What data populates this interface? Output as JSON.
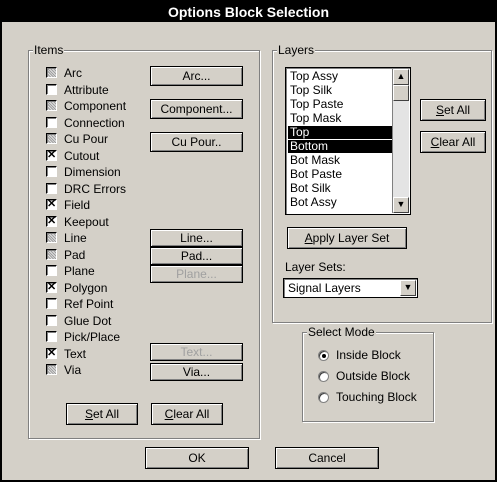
{
  "title": "Options Block Selection",
  "items_group": {
    "label": "Items",
    "checkboxes": [
      {
        "label": "Arc",
        "state": "indeterminate"
      },
      {
        "label": "Attribute",
        "state": "unchecked"
      },
      {
        "label": "Component",
        "state": "indeterminate"
      },
      {
        "label": "Connection",
        "state": "unchecked"
      },
      {
        "label": "Cu Pour",
        "state": "indeterminate"
      },
      {
        "label": "Cutout",
        "state": "checked"
      },
      {
        "label": "Dimension",
        "state": "unchecked"
      },
      {
        "label": "DRC Errors",
        "state": "unchecked"
      },
      {
        "label": "Field",
        "state": "checked"
      },
      {
        "label": "Keepout",
        "state": "checked"
      },
      {
        "label": "Line",
        "state": "indeterminate"
      },
      {
        "label": "Pad",
        "state": "indeterminate"
      },
      {
        "label": "Plane",
        "state": "unchecked"
      },
      {
        "label": "Polygon",
        "state": "checked"
      },
      {
        "label": "Ref Point",
        "state": "unchecked"
      },
      {
        "label": "Glue Dot",
        "state": "unchecked"
      },
      {
        "label": "Pick/Place",
        "state": "unchecked"
      },
      {
        "label": "Text",
        "state": "checked"
      },
      {
        "label": "Via",
        "state": "indeterminate"
      }
    ],
    "buttons": {
      "arc": "Arc...",
      "component": "Component...",
      "cu_pour": "Cu Pour..",
      "line": "Line...",
      "pad": "Pad...",
      "plane": "Plane...",
      "text": "Text...",
      "via": "Via..."
    },
    "set_all": "Set All",
    "clear_all": "Clear All"
  },
  "layers_group": {
    "label": "Layers",
    "items": [
      "Top Assy",
      "Top Silk",
      "Top Paste",
      "Top Mask",
      "Top",
      "Bottom",
      "Bot Mask",
      "Bot Paste",
      "Bot Silk",
      "Bot Assy"
    ],
    "selected": [
      "Top",
      "Bottom"
    ],
    "set_all": "Set All",
    "clear_all": "Clear All",
    "apply": "Apply Layer Set",
    "layer_sets_label": "Layer Sets:",
    "layer_set_value": "Signal Layers"
  },
  "select_mode": {
    "label": "Select Mode",
    "options": [
      "Inside Block",
      "Outside Block",
      "Touching Block"
    ],
    "selected": "Inside Block"
  },
  "ok": "OK",
  "cancel": "Cancel",
  "icons": {
    "check": "✕",
    "up_arrow": "▲",
    "down_arrow": "▼"
  }
}
